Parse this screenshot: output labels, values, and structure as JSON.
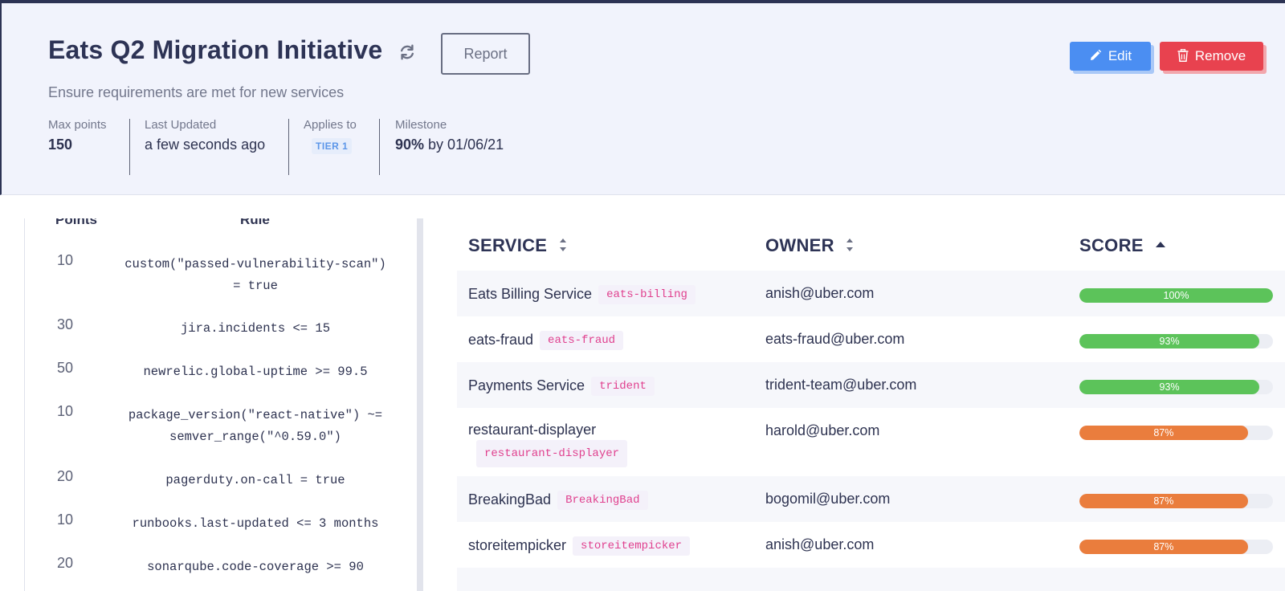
{
  "header": {
    "title": "Eats Q2 Migration Initiative",
    "subtitle": "Ensure requirements are met for new services",
    "report_label": "Report",
    "edit_label": "Edit",
    "remove_label": "Remove",
    "stats": {
      "max_points_label": "Max points",
      "max_points_value": "150",
      "last_updated_label": "Last Updated",
      "last_updated_value": "a few seconds ago",
      "applies_to_label": "Applies to",
      "applies_to_value": "TIER 1",
      "milestone_label": "Milestone",
      "milestone_percent": "90%",
      "milestone_rest": "by 01/06/21"
    }
  },
  "rules": {
    "points_header": "Points",
    "rule_header": "Rule",
    "items": [
      {
        "points": "10",
        "line1": "custom(\"passed-vulnerability-scan\")",
        "line2": "= true"
      },
      {
        "points": "30",
        "line1": "jira.incidents <= 15",
        "line2": ""
      },
      {
        "points": "50",
        "line1": "newrelic.global-uptime >= 99.5",
        "line2": ""
      },
      {
        "points": "10",
        "line1": "package_version(\"react-native\") ~=",
        "line2": "semver_range(\"^0.59.0\")"
      },
      {
        "points": "20",
        "line1": "pagerduty.on-call = true",
        "line2": ""
      },
      {
        "points": "10",
        "line1": "runbooks.last-updated <= 3 months",
        "line2": ""
      },
      {
        "points": "20",
        "line1": "sonarqube.code-coverage >= 90",
        "line2": ""
      }
    ]
  },
  "table": {
    "headers": {
      "service": "SERVICE",
      "owner": "OWNER",
      "score": "SCORE"
    },
    "rows": [
      {
        "service": "Eats Billing Service",
        "tag": "eats-billing",
        "owner": "anish@uber.com",
        "score": 100,
        "score_label": "100%",
        "color": "#5cc35a"
      },
      {
        "service": "eats-fraud",
        "tag": "eats-fraud",
        "owner": "eats-fraud@uber.com",
        "score": 93,
        "score_label": "93%",
        "color": "#5cc35a"
      },
      {
        "service": "Payments Service",
        "tag": "trident",
        "owner": "trident-team@uber.com",
        "score": 93,
        "score_label": "93%",
        "color": "#5cc35a"
      },
      {
        "service": "restaurant-displayer",
        "tag": "restaurant-displayer",
        "owner": "harold@uber.com",
        "score": 87,
        "score_label": "87%",
        "color": "#ea7d3d"
      },
      {
        "service": "BreakingBad",
        "tag": "BreakingBad",
        "owner": "bogomil@uber.com",
        "score": 87,
        "score_label": "87%",
        "color": "#ea7d3d"
      },
      {
        "service": "storeitempicker",
        "tag": "storeitempicker",
        "owner": "anish@uber.com",
        "score": 87,
        "score_label": "87%",
        "color": "#ea7d3d"
      }
    ]
  }
}
